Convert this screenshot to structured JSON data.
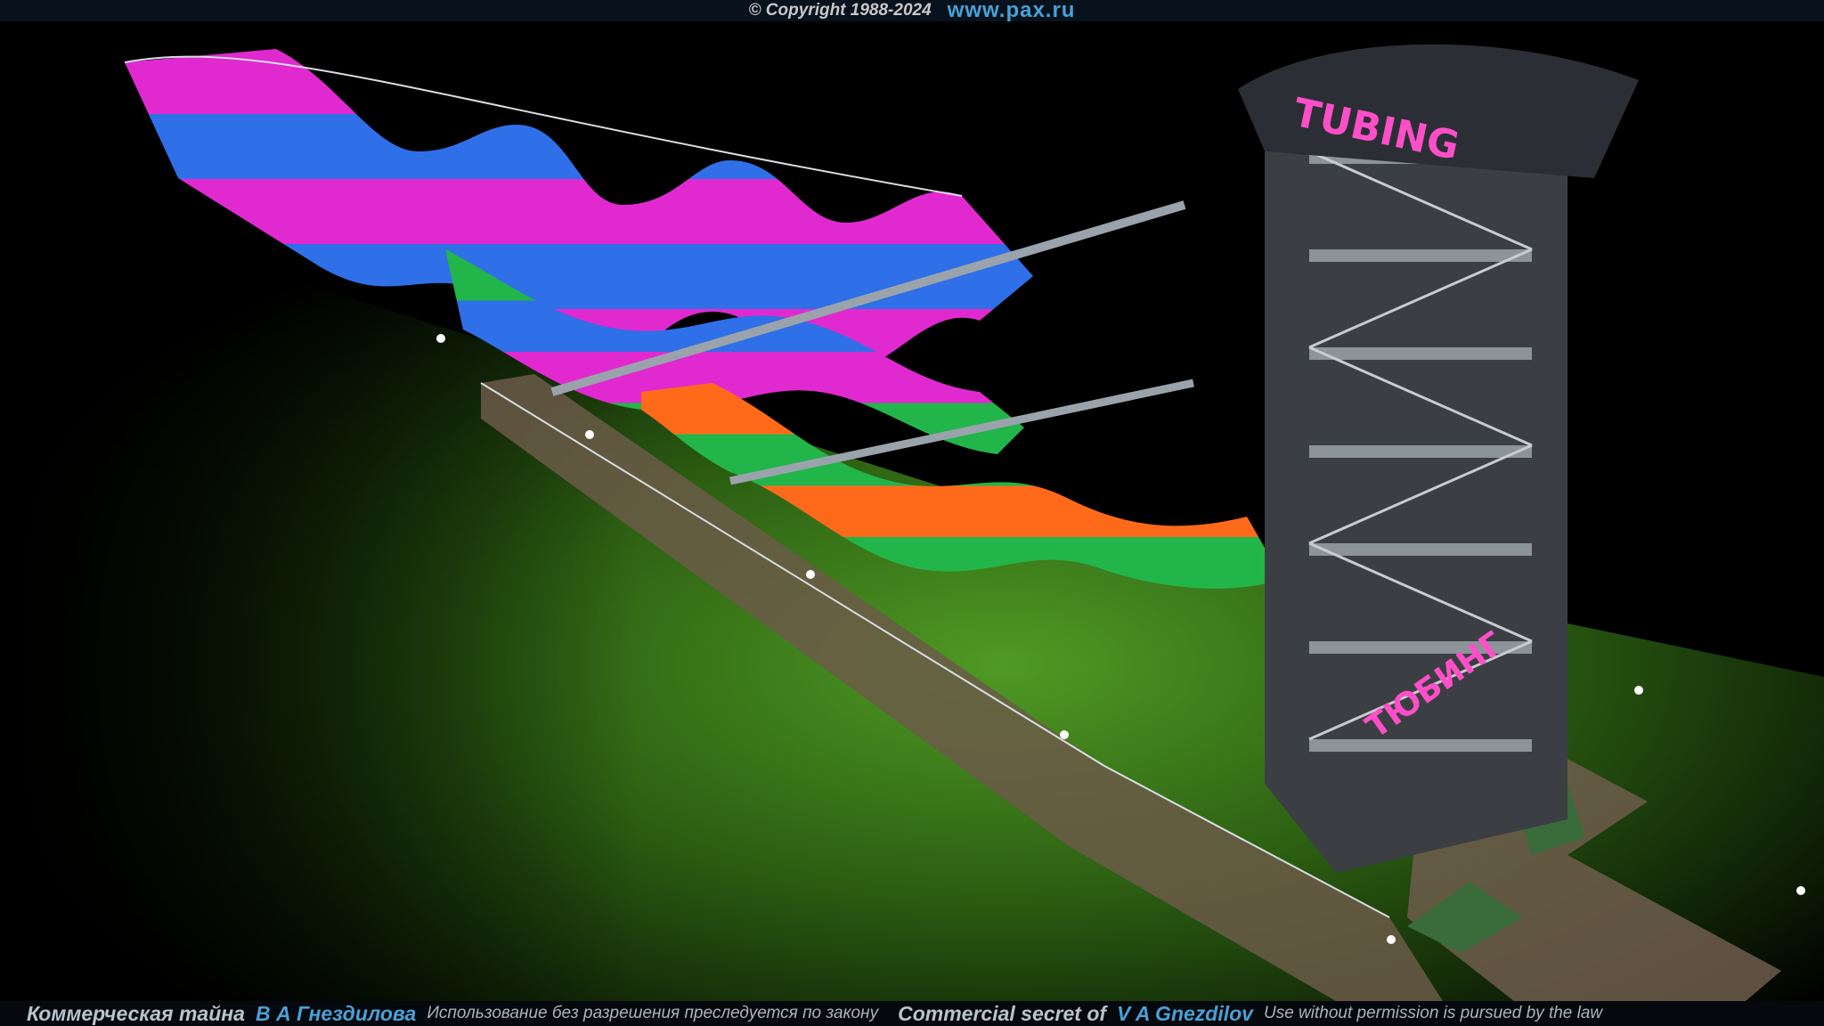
{
  "top_bar": {
    "copyright": "© Copyright 1988-2024",
    "site": "www.pax.ru"
  },
  "sign": {
    "top_text": "TUBING",
    "lower_text": "ТЮБИНГ"
  },
  "bottom_bar": {
    "ru_label": "Коммерческая тайна",
    "ru_author": "В А Гнездилова",
    "ru_notice": "Использование без разрешения преследуется по закону",
    "en_label": "Commercial secret of",
    "en_author": "V A Gnezdilov",
    "en_notice": "Use without permission is pursued by the law"
  },
  "colors": {
    "background": "#000000",
    "grass": "#3f7f1a",
    "sign_neon": "#ff4fc8",
    "slide_magenta": "#e02ad0",
    "slide_blue": "#2f6fe8",
    "slide_orange": "#ff6a1a",
    "slide_green": "#22b54a",
    "link_blue": "#4aa0d6"
  }
}
